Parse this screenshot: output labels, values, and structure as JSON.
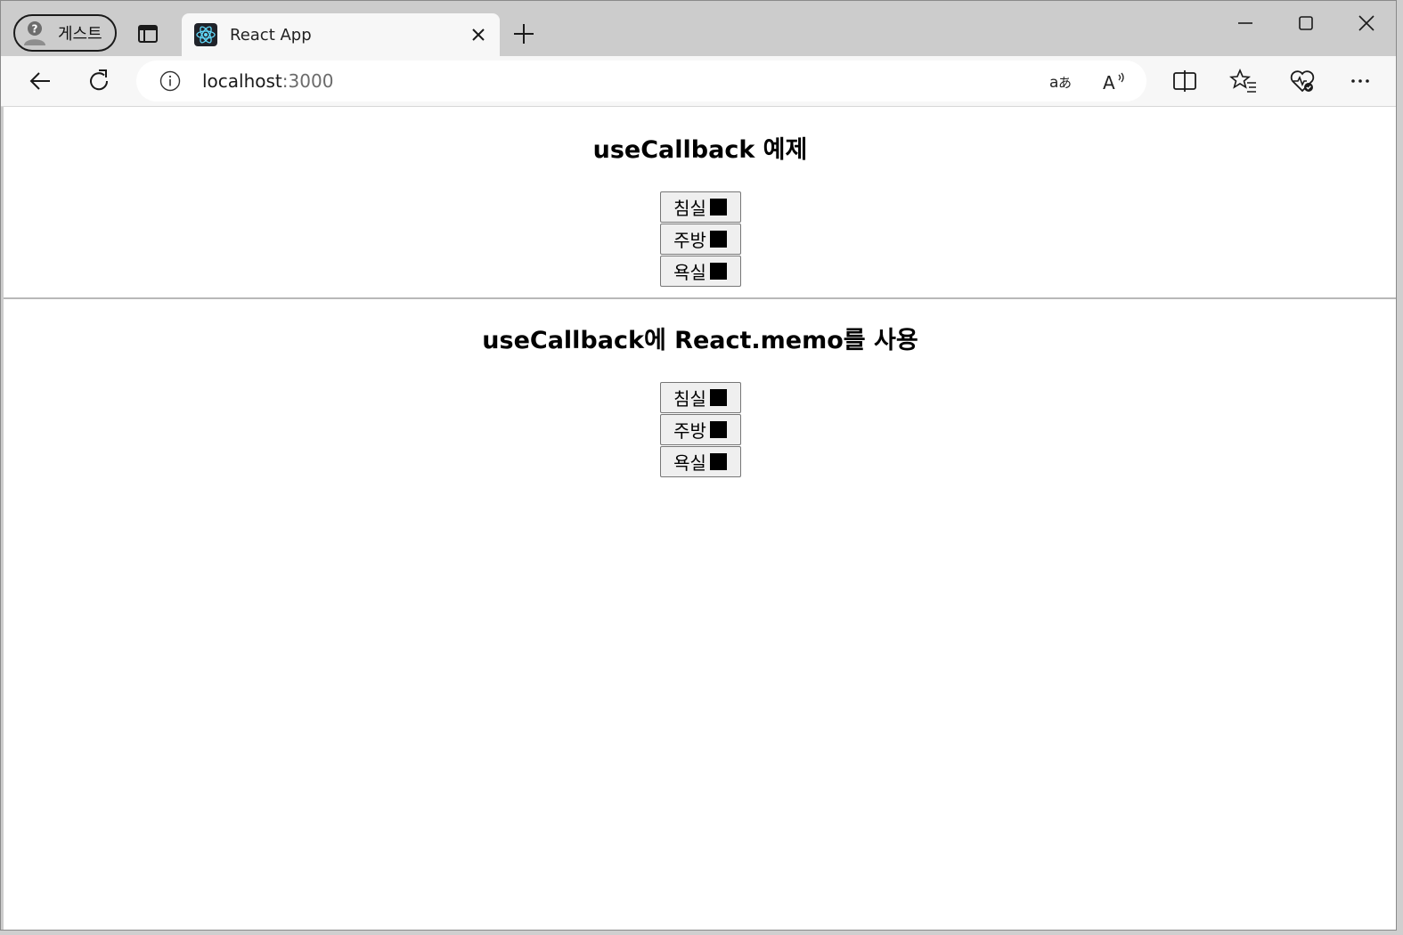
{
  "browser": {
    "profile_label": "게스트",
    "tab_title": "React App",
    "url_host": "localhost",
    "url_port": ":3000"
  },
  "sections": [
    {
      "heading": "useCallback 예제",
      "buttons": [
        {
          "label": "침실",
          "state_color": "#000000"
        },
        {
          "label": "주방",
          "state_color": "#000000"
        },
        {
          "label": "욕실",
          "state_color": "#000000"
        }
      ]
    },
    {
      "heading": "useCallback에 React.memo를 사용",
      "buttons": [
        {
          "label": "침실",
          "state_color": "#000000"
        },
        {
          "label": "주방",
          "state_color": "#000000"
        },
        {
          "label": "욕실",
          "state_color": "#000000"
        }
      ]
    }
  ],
  "colors": {
    "accent_react": "#61dafb",
    "tab_bg": "#f7f7f7",
    "chrome_bg": "#cccccc"
  }
}
